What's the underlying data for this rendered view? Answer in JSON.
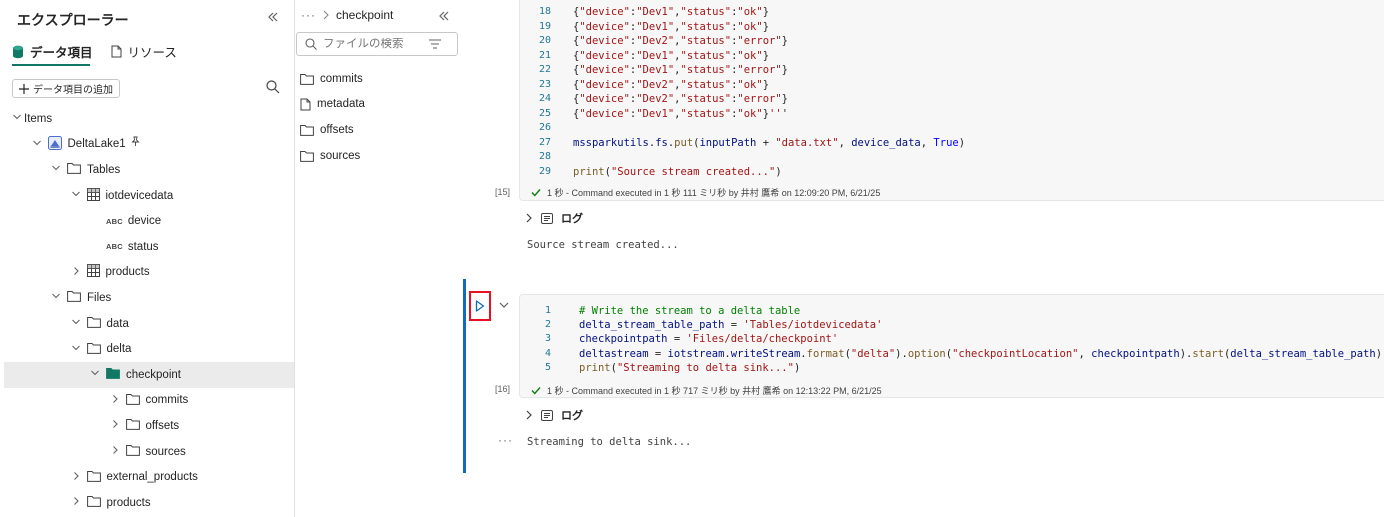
{
  "explorer": {
    "title": "エクスプローラー",
    "tabs": [
      {
        "label": "データ項目",
        "icon": "database-icon"
      },
      {
        "label": "リソース",
        "icon": "document-icon"
      }
    ],
    "add_button": "データ項目の追加",
    "tree": [
      {
        "label": "Items",
        "indent": 0,
        "chev": "down",
        "icon": "none"
      },
      {
        "label": "DeltaLake1",
        "indent": 1,
        "chev": "down",
        "icon": "lakehouse",
        "pinned": true
      },
      {
        "label": "Tables",
        "indent": 2,
        "chev": "down",
        "icon": "folder"
      },
      {
        "label": "iotdevicedata",
        "indent": 3,
        "chev": "down",
        "icon": "table"
      },
      {
        "label": "device",
        "indent": 4,
        "chev": "none",
        "icon": "abc"
      },
      {
        "label": "status",
        "indent": 4,
        "chev": "none",
        "icon": "abc"
      },
      {
        "label": "products",
        "indent": 3,
        "chev": "right",
        "icon": "table"
      },
      {
        "label": "Files",
        "indent": 2,
        "chev": "down",
        "icon": "folder"
      },
      {
        "label": "data",
        "indent": 3,
        "chev": "down",
        "icon": "folder"
      },
      {
        "label": "delta",
        "indent": 3,
        "chev": "down",
        "icon": "folder"
      },
      {
        "label": "checkpoint",
        "indent": 4,
        "chev": "down",
        "icon": "folder-filled",
        "selected": true
      },
      {
        "label": "commits",
        "indent": 5,
        "chev": "right",
        "icon": "folder"
      },
      {
        "label": "offsets",
        "indent": 5,
        "chev": "right",
        "icon": "folder"
      },
      {
        "label": "sources",
        "indent": 5,
        "chev": "right",
        "icon": "folder"
      },
      {
        "label": "external_products",
        "indent": 3,
        "chev": "right",
        "icon": "folder"
      },
      {
        "label": "products",
        "indent": 3,
        "chev": "right",
        "icon": "folder"
      }
    ],
    "abc_label": "ABC"
  },
  "files_pane": {
    "breadcrumb_dots": "···",
    "breadcrumb_current": "checkpoint",
    "search_placeholder": "ファイルの検索",
    "items": [
      {
        "label": "commits",
        "type": "folder"
      },
      {
        "label": "metadata",
        "type": "file"
      },
      {
        "label": "offsets",
        "type": "folder"
      },
      {
        "label": "sources",
        "type": "folder"
      }
    ]
  },
  "cell1": {
    "lines": [
      {
        "n": "18",
        "text": "{\"device\":\"Dev1\",\"status\":\"ok\"}"
      },
      {
        "n": "19",
        "text": "{\"device\":\"Dev1\",\"status\":\"ok\"}"
      },
      {
        "n": "20",
        "text": "{\"device\":\"Dev2\",\"status\":\"error\"}"
      },
      {
        "n": "21",
        "text": "{\"device\":\"Dev1\",\"status\":\"ok\"}"
      },
      {
        "n": "22",
        "text": "{\"device\":\"Dev1\",\"status\":\"error\"}"
      },
      {
        "n": "23",
        "text": "{\"device\":\"Dev2\",\"status\":\"ok\"}"
      },
      {
        "n": "24",
        "text": "{\"device\":\"Dev2\",\"status\":\"error\"}"
      },
      {
        "n": "25",
        "text": "{\"device\":\"Dev1\",\"status\":\"ok\"}'''"
      },
      {
        "n": "26",
        "text": ""
      },
      {
        "n": "27",
        "text": "mssparkutils.fs.put(inputPath + \"data.txt\", device_data, True)"
      },
      {
        "n": "28",
        "text": ""
      },
      {
        "n": "29",
        "text": "print(\"Source stream created...\")"
      }
    ],
    "exec_count": "[15]",
    "status": "1 秒 - Command executed in 1 秒 111 ミリ秒 by 井村 鷹希 on 12:09:20 PM, 6/21/25",
    "log_label": "ログ",
    "output": "Source stream created..."
  },
  "cell2": {
    "lines": [
      {
        "n": "1",
        "text": "# Write the stream to a delta table"
      },
      {
        "n": "2",
        "text": "delta_stream_table_path = 'Tables/iotdevicedata'"
      },
      {
        "n": "3",
        "text": "checkpointpath = 'Files/delta/checkpoint'"
      },
      {
        "n": "4",
        "text": "deltastream = iotstream.writeStream.format(\"delta\").option(\"checkpointLocation\", checkpointpath).start(delta_stream_table_path)"
      },
      {
        "n": "5",
        "text": "print(\"Streaming to delta sink...\")"
      }
    ],
    "exec_count": "[16]",
    "status": "1 秒 - Command executed in 1 秒 717 ミリ秒 by 井村 鷹希 on 12:13:22 PM, 6/21/25",
    "log_label": "ログ",
    "output": "Streaming to delta sink..."
  },
  "colors": {
    "accent": "#117865",
    "active_cell": "#0f6cbd",
    "highlight": "#e81123",
    "success": "#107c10"
  }
}
